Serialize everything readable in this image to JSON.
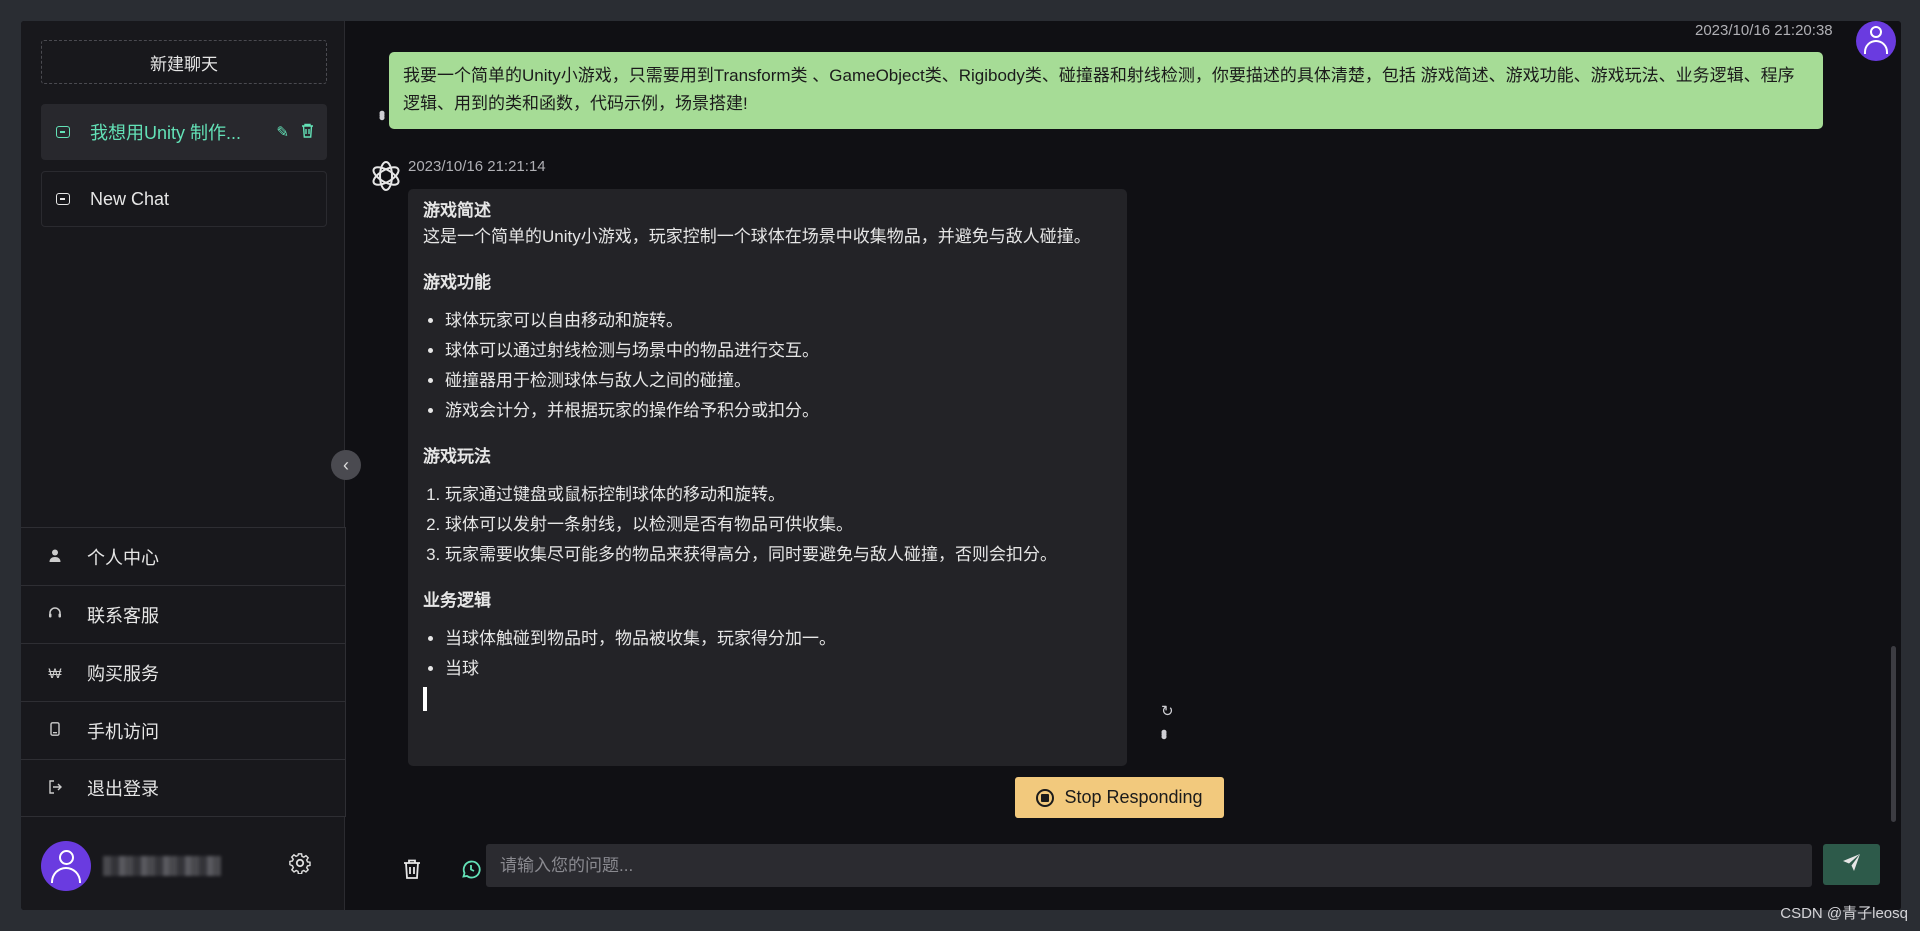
{
  "sidebar": {
    "new_chat_label": "新建聊天",
    "chats": [
      {
        "label": "我想用Unity 制作...",
        "active": true
      },
      {
        "label": "New Chat",
        "active": false
      }
    ],
    "menu": [
      {
        "label": "个人中心",
        "icon": "person-icon"
      },
      {
        "label": "联系客服",
        "icon": "headset-icon"
      },
      {
        "label": "购买服务",
        "icon": "currency-icon"
      },
      {
        "label": "手机访问",
        "icon": "phone-icon"
      },
      {
        "label": "退出登录",
        "icon": "logout-icon"
      }
    ]
  },
  "conversation": {
    "user_time": "2023/10/16 21:20:38",
    "user_message": "我要一个简单的Unity小游戏，只需要用到Transform类 、GameObject类、Rigibody类、碰撞器和射线检测，你要描述的具体清楚，包括 游戏简述、游戏功能、游戏玩法、业务逻辑、程序逻辑、用到的类和函数，代码示例，场景搭建!",
    "bot_time": "2023/10/16 21:21:14",
    "bot": {
      "s1_title": "游戏简述",
      "s1_text": "这是一个简单的Unity小游戏，玩家控制一个球体在场景中收集物品，并避免与敌人碰撞。",
      "s2_title": "游戏功能",
      "s2_items": [
        "球体玩家可以自由移动和旋转。",
        "球体可以通过射线检测与场景中的物品进行交互。",
        "碰撞器用于检测球体与敌人之间的碰撞。",
        "游戏会计分，并根据玩家的操作给予积分或扣分。"
      ],
      "s3_title": "游戏玩法",
      "s3_items": [
        "玩家通过键盘或鼠标控制球体的移动和旋转。",
        "球体可以发射一条射线，以检测是否有物品可供收集。",
        "玩家需要收集尽可能多的物品来获得高分，同时要避免与敌人碰撞，否则会扣分。"
      ],
      "s4_title": "业务逻辑",
      "s4_items": [
        "当球体触碰到物品时，物品被收集，玩家得分加一。",
        "当球"
      ]
    }
  },
  "stop_label": "Stop Responding",
  "input": {
    "placeholder": "请输入您的问题..."
  },
  "watermark": "CSDN @青子leosq",
  "colors": {
    "accent_green": "#63e2b7",
    "user_bubble": "#a6dc96",
    "stop_button": "#f2c97d",
    "avatar": "#6a3be0"
  }
}
